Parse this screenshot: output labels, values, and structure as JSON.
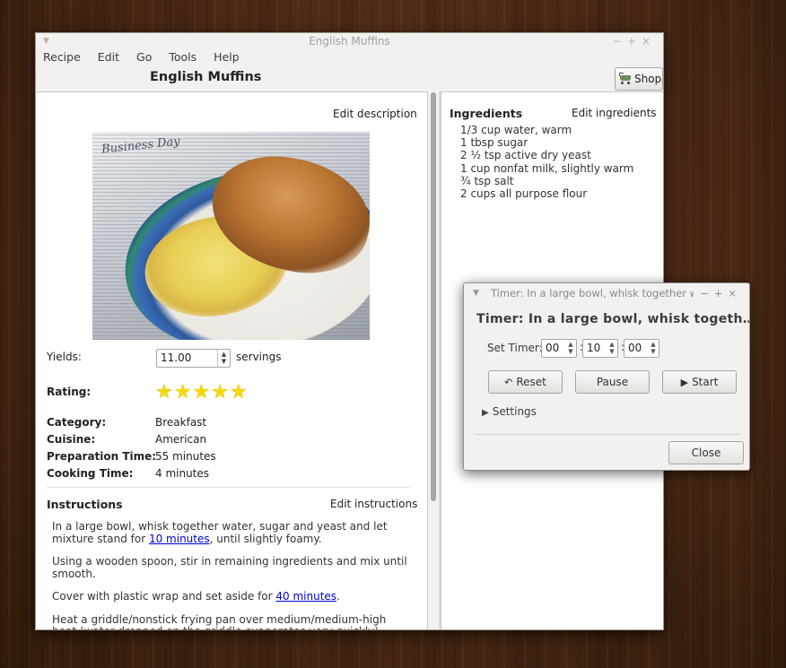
{
  "main_window": {
    "title": "English Muffins",
    "menu": [
      "Recipe",
      "Edit",
      "Go",
      "Tools",
      "Help"
    ],
    "recipe_title": "English Muffins",
    "shop_label": "Shop"
  },
  "left_pane": {
    "edit_description": "Edit description",
    "yields_label": "Yields:",
    "yields_value": "11.00",
    "yields_unit": "servings",
    "rating_label": "Rating:",
    "rating_stars": 5,
    "category_label": "Category:",
    "category_value": "Breakfast",
    "cuisine_label": "Cuisine:",
    "cuisine_value": "American",
    "prep_label": "Preparation Time:",
    "prep_value": "55 minutes",
    "cook_label": "Cooking Time:",
    "cook_value": "4 minutes",
    "photo_banner": "Business Day"
  },
  "instructions": {
    "heading": "Instructions",
    "edit_label": "Edit instructions",
    "p1_before": "In a large bowl, whisk together water, sugar and yeast and let mixture stand for ",
    "p1_link": "10 minutes",
    "p1_after": ", until slightly foamy.",
    "p2": "Using a wooden spoon, stir in remaining ingredients and mix until smooth.",
    "p3_before": "Cover with plastic wrap and set aside for ",
    "p3_link": "40 minutes",
    "p3_after": ".",
    "p4": "Heat a griddle/nonstick frying pan over medium/medium-high heat (water dropped on the griddle evaporates very quickly). Lightly grease"
  },
  "ingredients": {
    "heading": "Ingredients",
    "edit_label": "Edit ingredients",
    "items": [
      "1/3 cup water, warm",
      "1 tbsp sugar",
      "2 ½  tsp active dry yeast",
      "1 cup nonfat milk, slightly warm",
      "¾  tsp salt",
      "2 cups all purpose flour"
    ]
  },
  "timer": {
    "window_title": "Timer: In a large bowl, whisk together water",
    "heading": "Timer: In a large bowl, whisk togeth…",
    "set_timer_label": "Set Timer:",
    "hours": "00",
    "minutes": "10",
    "seconds": "00",
    "reset_label": "Reset",
    "pause_label": "Pause",
    "start_label": "Start",
    "settings_label": "Settings",
    "close_label": "Close"
  }
}
